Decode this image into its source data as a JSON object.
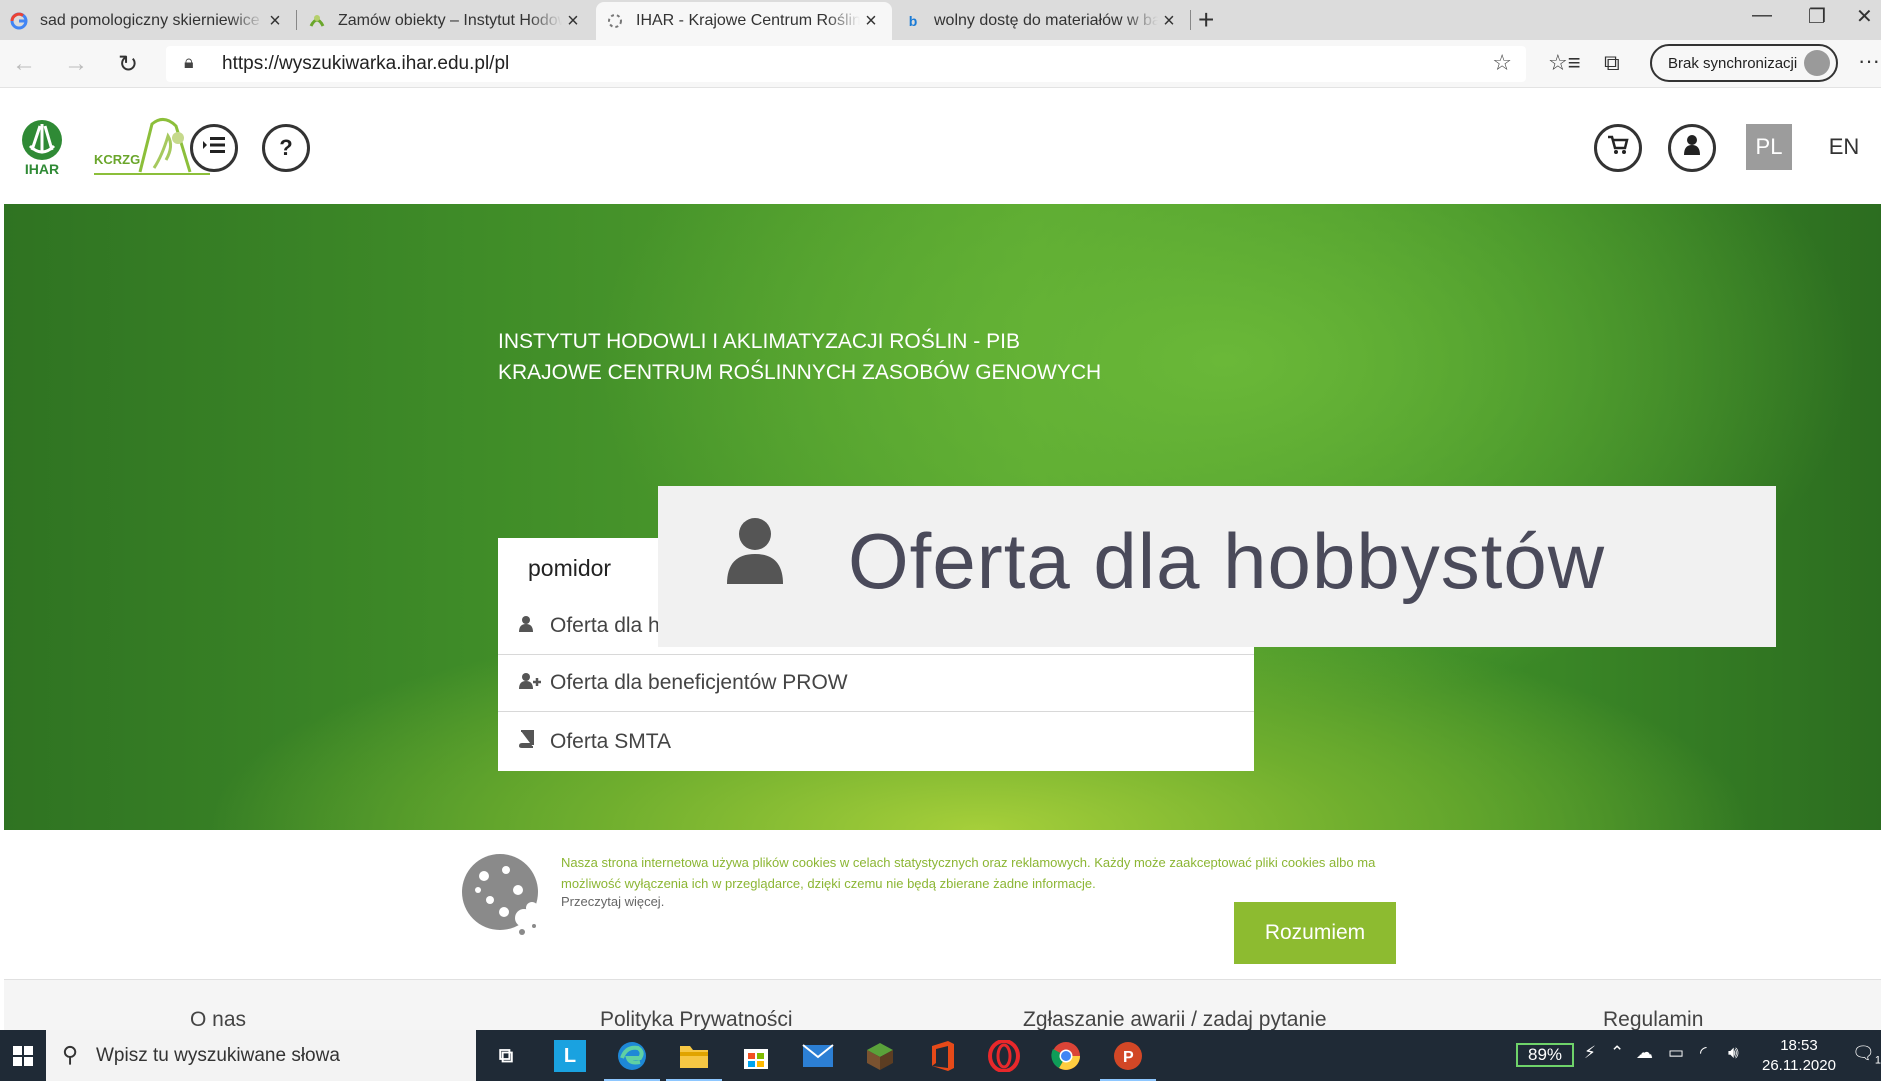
{
  "browser": {
    "tabs": [
      {
        "title": "sad pomologiczny skierniewice - ",
        "favicon": "google-icon"
      },
      {
        "title": "Zamów obiekty – Instytut Hodow",
        "favicon": "ihar-icon"
      },
      {
        "title": "IHAR - Krajowe Centrum Roślinn",
        "favicon": "loading-icon",
        "active": true
      },
      {
        "title": "wolny dostę do materiałów w ba",
        "favicon": "bing-icon"
      }
    ],
    "url": "https://wyszukiwarka.ihar.edu.pl/pl",
    "sync_label": "Brak synchronizacji"
  },
  "header": {
    "logo_ihar_text": "IHAR",
    "logo_kcrzg_text": "KCRZG",
    "help_label": "?",
    "lang_pl": "PL",
    "lang_en": "EN"
  },
  "hero": {
    "title_line1": "INSTYTUT HODOWLI I AKLIMATYZACJI ROŚLIN - PIB",
    "title_line2": "KRAJOWE CENTRUM ROŚLINNYCH ZASOBÓW GENOWYCH",
    "search_value": "pomidor",
    "dropdown": [
      {
        "label": "Oferta dla h",
        "icon": "user-icon"
      },
      {
        "label": "Oferta dla beneficjentów PROW",
        "icon": "user-plus-icon"
      },
      {
        "label": "Oferta SMTA",
        "icon": "book-icon"
      }
    ],
    "zoom_tooltip": "Oferta dla hobbystów"
  },
  "cookie": {
    "text": "Nasza strona internetowa używa plików cookies w celach statystycznych oraz reklamowych. Każdy może zaakceptować pliki cookies albo ma możliwość wyłączenia ich w przeglądarce, dzięki czemu nie będą zbierane żadne informacje.",
    "more": "Przeczytaj więcej.",
    "accept_label": "Rozumiem"
  },
  "footer": {
    "links": [
      "O nas",
      "Polityka Prywatności",
      "Zgłaszanie awarii / zadaj pytanie",
      "Regulamin"
    ]
  },
  "taskbar": {
    "search_placeholder": "Wpisz tu wyszukiwane słowa",
    "battery": "89%",
    "time": "18:53",
    "date": "26.11.2020",
    "notifications": "1"
  },
  "colors": {
    "brand_green": "#8dbb30",
    "hero_green": "#4f9a2d",
    "taskbar": "#1f2a36"
  }
}
